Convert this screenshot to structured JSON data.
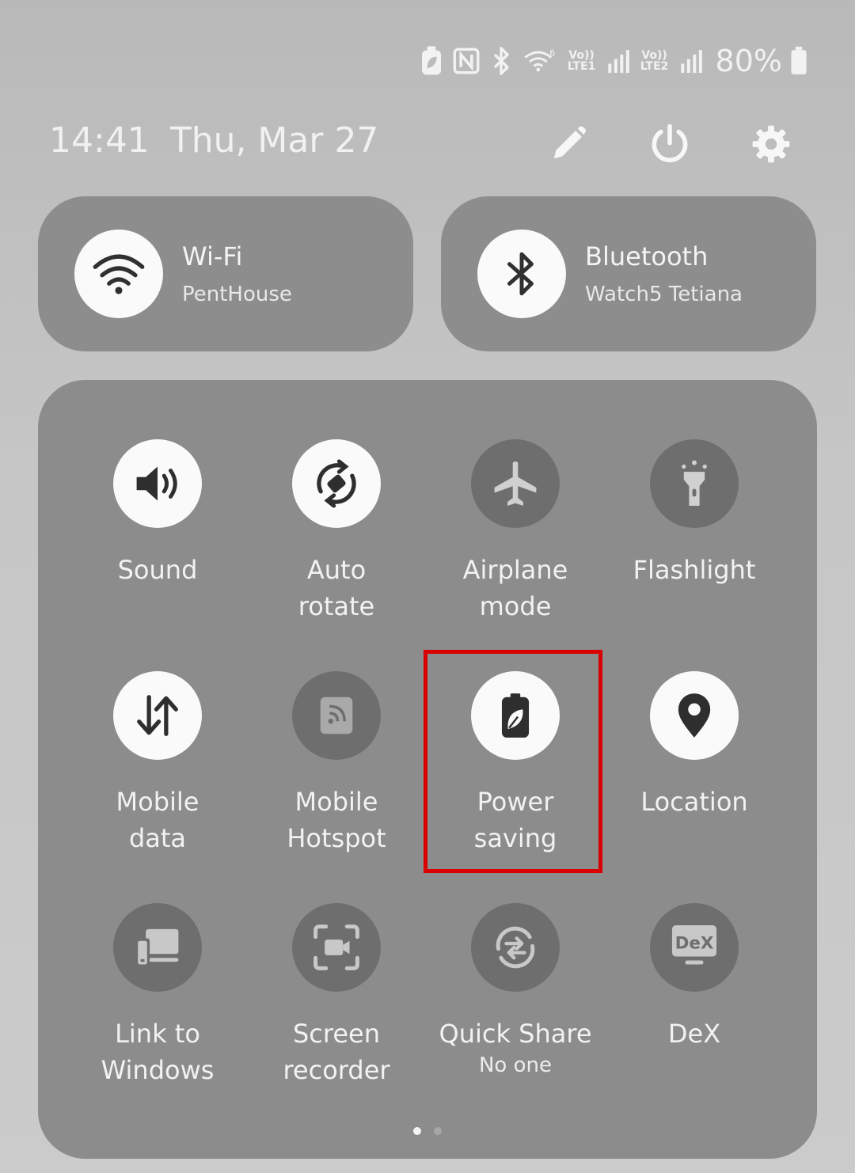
{
  "status_bar": {
    "lte1": "Vo))\nLTE1",
    "lte2": "Vo))\nLTE2",
    "battery": "80%",
    "icons": [
      "battery-saver-icon",
      "nfc-icon",
      "bluetooth-icon",
      "wifi-6-icon",
      "signal-icon",
      "signal-icon"
    ]
  },
  "header": {
    "time": "14:41",
    "date": "Thu, Mar 27",
    "actions": [
      "edit-icon",
      "power-icon",
      "settings-icon"
    ]
  },
  "wide_tiles": [
    {
      "title": "Wi-Fi",
      "subtitle": "PentHouse",
      "icon": "wifi-icon",
      "state": "on"
    },
    {
      "title": "Bluetooth",
      "subtitle": "Watch5 Tetiana",
      "icon": "bluetooth-icon",
      "state": "on"
    }
  ],
  "tiles": [
    {
      "label": "Sound",
      "icon": "sound-icon",
      "state": "on"
    },
    {
      "label": "Auto\nrotate",
      "icon": "auto-rotate-icon",
      "state": "on"
    },
    {
      "label": "Airplane\nmode",
      "icon": "airplane-icon",
      "state": "off"
    },
    {
      "label": "Flashlight",
      "icon": "flashlight-icon",
      "state": "off"
    },
    {
      "label": "Mobile\ndata",
      "icon": "mobile-data-icon",
      "state": "on"
    },
    {
      "label": "Mobile\nHotspot",
      "icon": "hotspot-icon",
      "state": "off"
    },
    {
      "label": "Power\nsaving",
      "icon": "power-saving-icon",
      "state": "on",
      "highlighted": true
    },
    {
      "label": "Location",
      "icon": "location-icon",
      "state": "on"
    },
    {
      "label": "Link to\nWindows",
      "icon": "link-to-windows-icon",
      "state": "off"
    },
    {
      "label": "Screen\nrecorder",
      "icon": "screen-recorder-icon",
      "state": "off"
    },
    {
      "label": "Quick Share",
      "sublabel": "No one",
      "icon": "quick-share-icon",
      "state": "off"
    },
    {
      "label": "DeX",
      "icon": "dex-icon",
      "state": "off",
      "icon_text": "DeX"
    }
  ],
  "pager": {
    "pages": 2,
    "current": 1
  },
  "colors": {
    "highlight": "#d80000",
    "tile_on": "#fafafa",
    "tile_off": "#6e6e6e",
    "panel": "#8c8c8c"
  }
}
